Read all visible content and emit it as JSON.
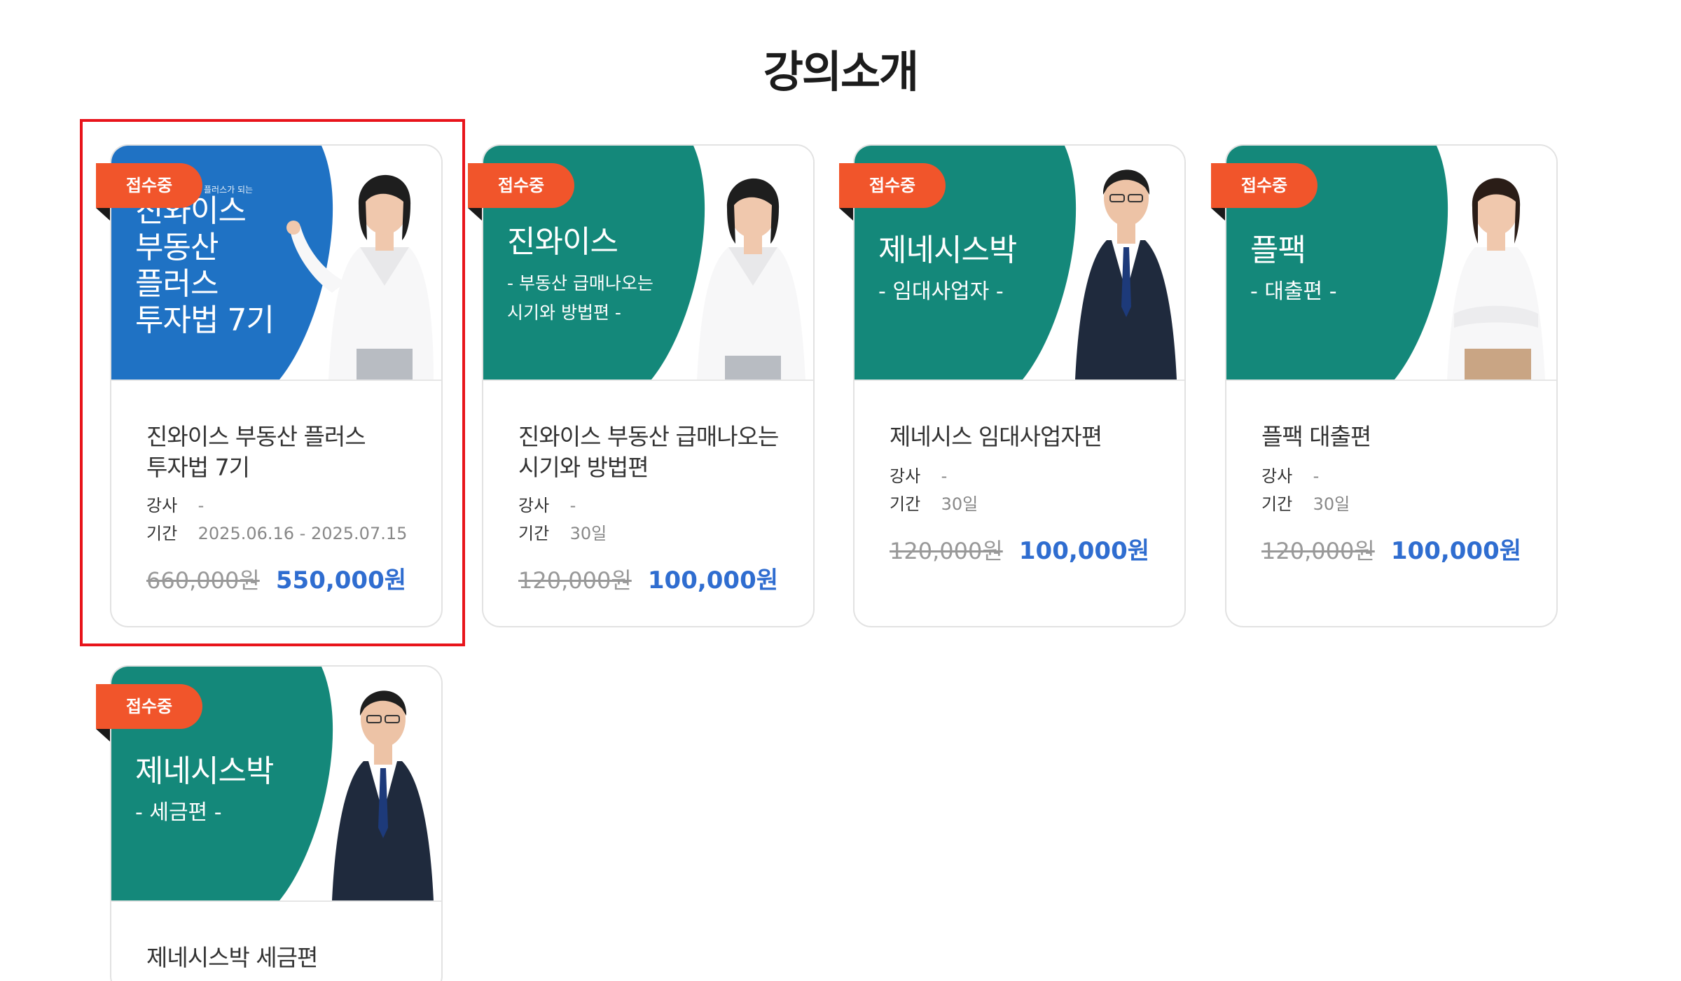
{
  "section_title": "강의소개",
  "badge_label": "접수중",
  "meta_labels": {
    "instructor": "강사",
    "period": "기간"
  },
  "courses": [
    {
      "thumb_small": "플러스가 되는",
      "thumb_title": "진와이스\n부동산\n플러스\n투자법 7기",
      "thumb_sub": "",
      "title": "진와이스 부동산 플러스\n투자법 7기",
      "instructor": "-",
      "period": "2025.06.16 - 2025.07.15",
      "original_price": "660,000원",
      "sale_price": "550,000원",
      "thumb_color": "#1f72c4"
    },
    {
      "thumb_small": "",
      "thumb_title": "진와이스",
      "thumb_sub": "- 부동산 급매나오는\n  시기와 방법편 -",
      "title": "진와이스 부동산 급매나오는\n시기와 방법편",
      "instructor": "-",
      "period": "30일",
      "original_price": "120,000원",
      "sale_price": "100,000원",
      "thumb_color": "#14887a"
    },
    {
      "thumb_small": "",
      "thumb_title": "제네시스박",
      "thumb_sub": "- 임대사업자 -",
      "title": "제네시스 임대사업자편",
      "instructor": "-",
      "period": "30일",
      "original_price": "120,000원",
      "sale_price": "100,000원",
      "thumb_color": "#14887a"
    },
    {
      "thumb_small": "",
      "thumb_title": "플팩",
      "thumb_sub": "- 대출편 -",
      "title": "플팩 대출편",
      "instructor": "-",
      "period": "30일",
      "original_price": "120,000원",
      "sale_price": "100,000원",
      "thumb_color": "#14887a"
    },
    {
      "thumb_small": "",
      "thumb_title": "제네시스박",
      "thumb_sub": "- 세금편 -",
      "title": "제네시스박 세금편",
      "instructor": "",
      "period": "",
      "original_price": "",
      "sale_price": "",
      "thumb_color": "#14887a"
    }
  ]
}
